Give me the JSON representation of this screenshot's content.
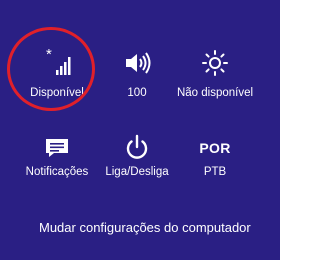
{
  "colors": {
    "background": "#2a1f84",
    "foreground": "#ffffff",
    "highlight_circle": "#e0202a"
  },
  "quick_settings": {
    "network": {
      "label": "Disponível",
      "icon": "network-signal-icon"
    },
    "volume": {
      "label": "100",
      "icon": "speaker-volume-icon"
    },
    "brightness": {
      "label": "Não disponível",
      "icon": "brightness-sun-icon"
    },
    "notifications": {
      "label": "Notificações",
      "icon": "notifications-icon"
    },
    "power": {
      "label": "Liga/Desliga",
      "icon": "power-icon"
    },
    "language": {
      "code": "POR",
      "label": "PTB"
    }
  },
  "footer": {
    "change_settings_link": "Mudar configurações do computador"
  }
}
